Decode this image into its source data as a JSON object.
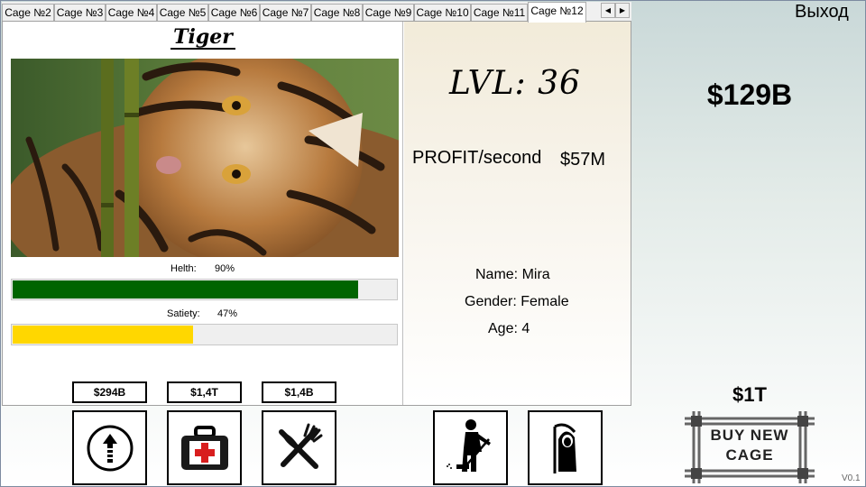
{
  "tabs": [
    {
      "label": "Cage №2"
    },
    {
      "label": "Cage №3"
    },
    {
      "label": "Cage №4"
    },
    {
      "label": "Cage №5"
    },
    {
      "label": "Cage №6"
    },
    {
      "label": "Cage №7"
    },
    {
      "label": "Cage №8"
    },
    {
      "label": "Cage №9"
    },
    {
      "label": "Cage №10"
    },
    {
      "label": "Cage №11"
    },
    {
      "label": "Cage №12"
    }
  ],
  "active_tab": "Cage №12",
  "tab_scroll": {
    "left": "◀",
    "right": "▶"
  },
  "exit_label": "Выход",
  "balance": "$129B",
  "animal": {
    "name": "Tiger",
    "health_label": "Helth:",
    "health_value": "90%",
    "health_fraction": 0.9,
    "satiety_label": "Satiety:",
    "satiety_value": "47%",
    "satiety_fraction": 0.47,
    "level": "LVL: 36",
    "profit_label": "PROFIT/second",
    "profit_value": "$57M",
    "name_line": "Name: Mira",
    "gender_line": "Gender: Female",
    "age_line": "Age: 4"
  },
  "colors": {
    "health_bar": "#006400",
    "satiety_bar": "#ffd700"
  },
  "actions": {
    "upgrade_price": "$294B",
    "heal_price": "$1,4T",
    "feed_price": "$1,4B",
    "upgrade_icon": "arrow-up-circle-icon",
    "heal_icon": "first-aid-kit-icon",
    "feed_icon": "fork-knife-icon",
    "clean_icon": "janitor-sweeping-icon",
    "reaper_icon": "grim-reaper-icon"
  },
  "buy_cage": {
    "price": "$1T",
    "line1": "BUY NEW",
    "line2": "CAGE"
  },
  "version": "V0.1"
}
